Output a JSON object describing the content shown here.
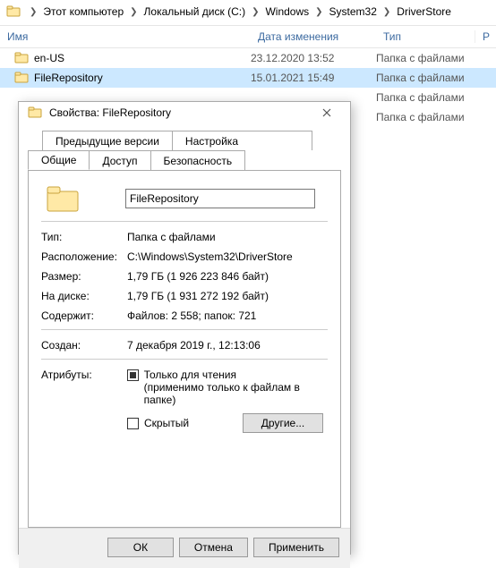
{
  "breadcrumb": {
    "items": [
      "Этот компьютер",
      "Локальный диск (C:)",
      "Windows",
      "System32",
      "DriverStore"
    ]
  },
  "columns": {
    "name": "Имя",
    "date": "Дата изменения",
    "type": "Тип",
    "last": "Р"
  },
  "rows": [
    {
      "name": "en-US",
      "date": "23.12.2020 13:52",
      "type": "Папка с файлами",
      "selected": false
    },
    {
      "name": "FileRepository",
      "date": "15.01.2021 15:49",
      "type": "Папка с файлами",
      "selected": true
    },
    {
      "name": "",
      "date": "",
      "type": "Папка с файлами",
      "selected": false
    },
    {
      "name": "",
      "date": "",
      "type": "Папка с файлами",
      "selected": false
    }
  ],
  "dialog": {
    "title": "Свойства: FileRepository",
    "tabs_top": [
      "Предыдущие версии",
      "Настройка"
    ],
    "tabs_bottom": [
      "Общие",
      "Доступ",
      "Безопасность"
    ],
    "active_tab": "Общие",
    "name_value": "FileRepository",
    "fields": {
      "type_label": "Тип:",
      "type_value": "Папка с файлами",
      "location_label": "Расположение:",
      "location_value": "C:\\Windows\\System32\\DriverStore",
      "size_label": "Размер:",
      "size_value": "1,79 ГБ (1 926 223 846 байт)",
      "ondisk_label": "На диске:",
      "ondisk_value": "1,79 ГБ (1 931 272 192 байт)",
      "contains_label": "Содержит:",
      "contains_value": "Файлов: 2 558; папок: 721",
      "created_label": "Создан:",
      "created_value": "7 декабря 2019 г., 12:13:06",
      "attr_label": "Атрибуты:",
      "readonly_label": "Только для чтения",
      "readonly_sub": "(применимо только к файлам в папке)",
      "hidden_label": "Скрытый",
      "other_btn": "Другие..."
    },
    "buttons": {
      "ok": "ОК",
      "cancel": "Отмена",
      "apply": "Применить"
    }
  }
}
